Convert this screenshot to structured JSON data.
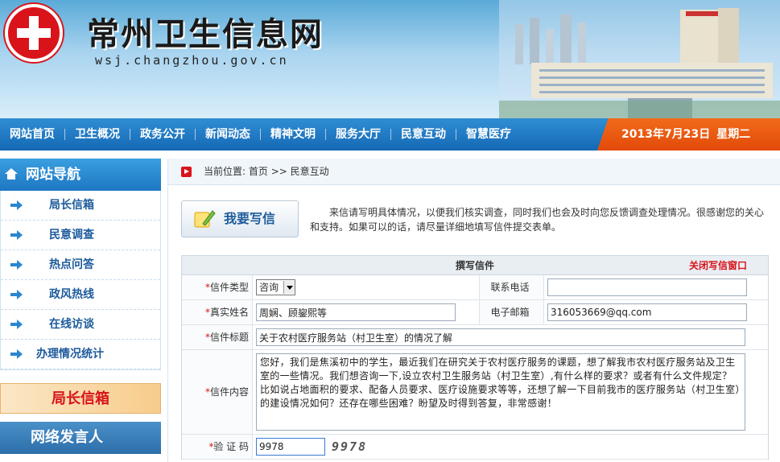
{
  "site": {
    "title": "常州卫生信息网",
    "url": "wsj.changzhou.gov.cn"
  },
  "nav": {
    "items": [
      "网站首页",
      "卫生概况",
      "政务公开",
      "新闻动态",
      "精神文明",
      "服务大厅",
      "民意互动",
      "智慧医疗"
    ],
    "date": "2013年7月23日",
    "weekday": "星期二"
  },
  "sidebar": {
    "title": "网站导航",
    "items": [
      "局长信箱",
      "民意调查",
      "热点问答",
      "政风热线",
      "在线访谈",
      "办理情况统计"
    ],
    "banner1": "局长信箱",
    "banner2": "网络发言人"
  },
  "breadcrumb": {
    "prefix": "当前位置:",
    "home": "首页",
    "sep": ">>",
    "current": "民意互动"
  },
  "write_button": "我要写信",
  "intro": "来信请写明具体情况，以便我们核实调查，同时我们也会及时向您反馈调查处理情况。很感谢您的关心和支持。如果可以的话，请尽量详细地填写信件提交表单。",
  "form": {
    "title": "撰写信件",
    "close": "关闭写信窗口",
    "star": "*",
    "type_label": "信件类型",
    "type_value": "咨询",
    "phone_label": "联系电话",
    "phone_value": "",
    "name_label": "真实姓名",
    "name_value": "周娴、顾鋆熙等",
    "email_label": "电子邮箱",
    "email_value": "316053669@qq.com",
    "subject_label": "信件标题",
    "subject_value": "关于农村医疗服务站（村卫生室）的情况了解",
    "content_label": "信件内容",
    "content_value": "您好，我们是焦溪初中的学生，最近我们在研究关于农村医疗服务的课题，想了解我市农村医疗服务站及卫生室的一些情况。我们想咨询一下,设立农村卫生服务站（村卫生室）,有什么样的要求？或者有什么文件规定？比如说占地面积的要求、配备人员要求、医疗设施要求等等，还想了解一下目前我市的医疗服务站（村卫生室）的建设情况如何？还存在哪些困难？盼望及时得到答复，非常感谢！",
    "captcha_label": "验 证 码",
    "captcha_value": "9978",
    "captcha_image": "9978"
  }
}
